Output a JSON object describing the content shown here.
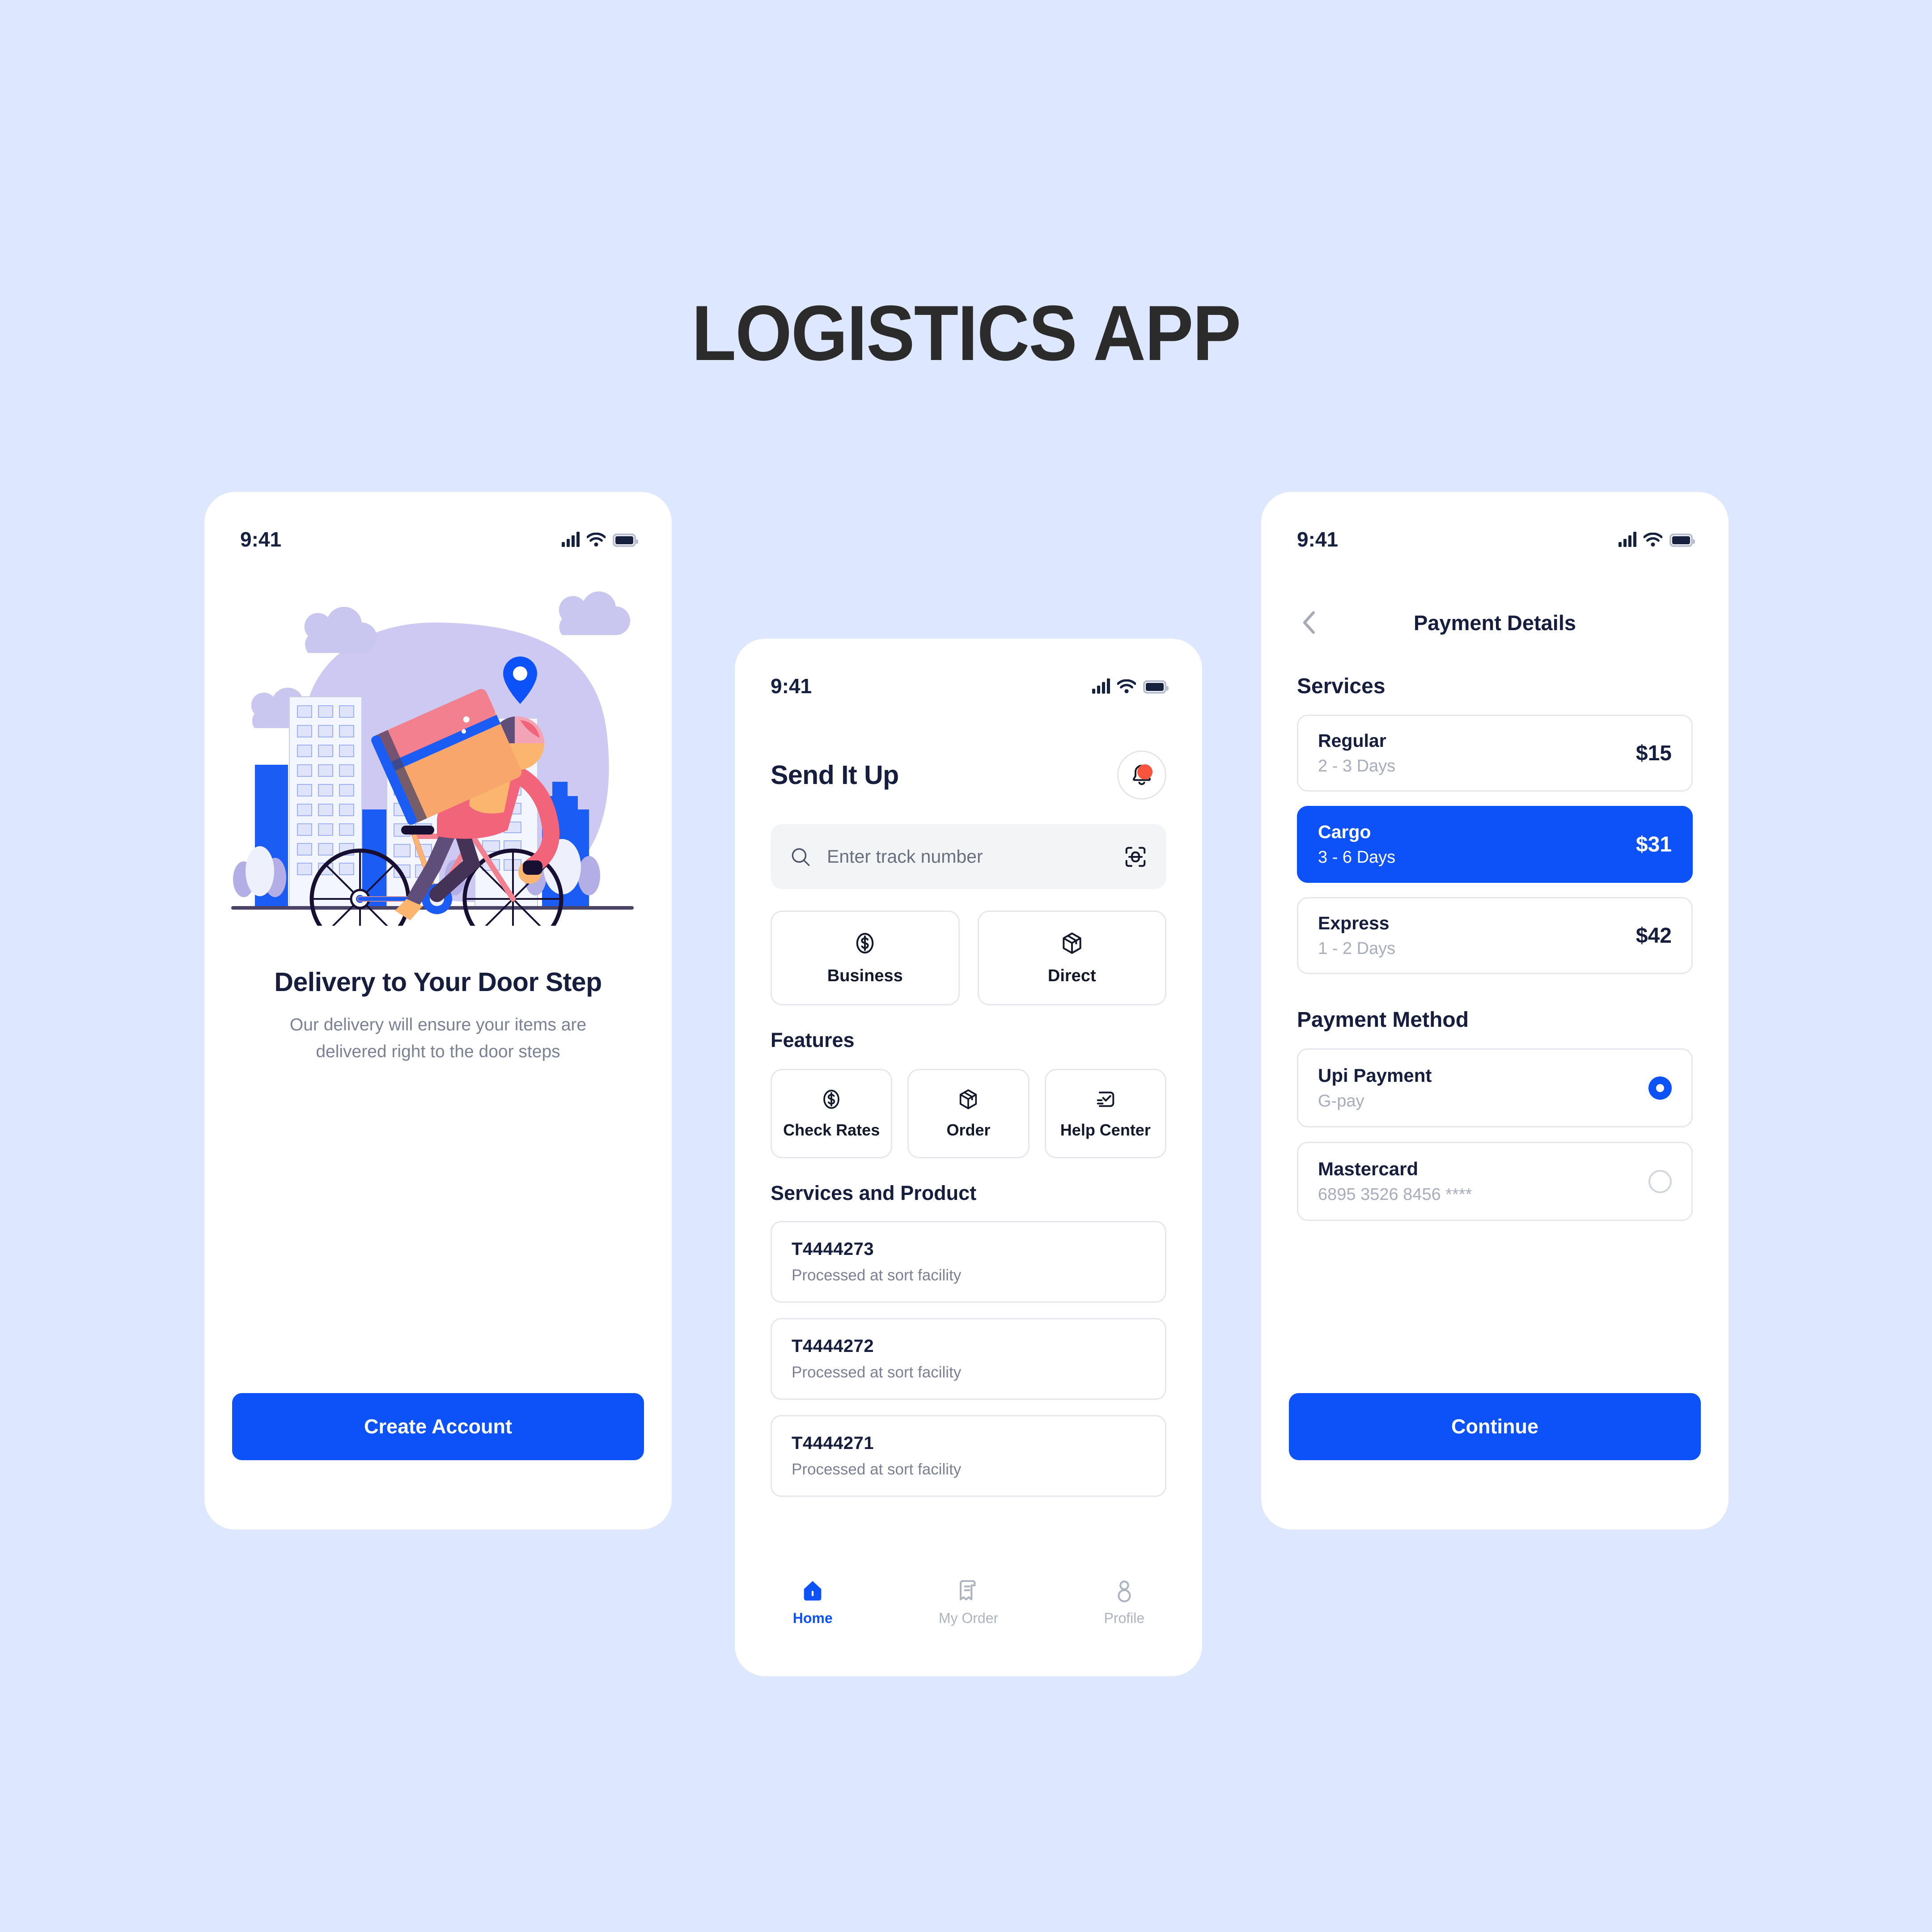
{
  "page": {
    "title": "LOGISTICS APP",
    "background_color": "#dde7ff",
    "accent_color": "#0d52f9",
    "notification_dot_color": "#f9543e"
  },
  "status_bar": {
    "time": "9:41",
    "icons": [
      "cellular-signal-icon",
      "wifi-icon",
      "battery-icon"
    ]
  },
  "onboarding_screen": {
    "illustration": "delivery-cyclist-illustration",
    "heading": "Delivery to Your Door Step",
    "subtitle": "Our delivery will ensure your items are delivered right to the door steps",
    "cta_label": "Create Account"
  },
  "home_screen": {
    "app_title": "Send It Up",
    "notification_icon": "bell-icon",
    "search": {
      "placeholder": "Enter track number",
      "value": "",
      "left_icon": "search-icon",
      "right_icon": "scan-barcode-icon"
    },
    "quick_tiles": [
      {
        "label": "Business",
        "icon": "dollar-circle-icon"
      },
      {
        "label": "Direct",
        "icon": "package-box-icon"
      }
    ],
    "features_heading": "Features",
    "features": [
      {
        "label": "Check Rates",
        "icon": "dollar-circle-icon"
      },
      {
        "label": "Order",
        "icon": "package-box-icon"
      },
      {
        "label": "Help Center",
        "icon": "chat-support-icon"
      }
    ],
    "services_heading": "Services and Product",
    "tracking_items": [
      {
        "id": "T4444273",
        "status": "Processed at sort facility"
      },
      {
        "id": "T4444272",
        "status": "Processed at sort facility"
      },
      {
        "id": "T4444271",
        "status": "Processed at sort facility"
      }
    ],
    "tabs": [
      {
        "label": "Home",
        "icon": "home-icon",
        "active": true
      },
      {
        "label": "My Order",
        "icon": "receipt-icon",
        "active": false
      },
      {
        "label": "Profile",
        "icon": "person-icon",
        "active": false
      }
    ]
  },
  "payment_screen": {
    "back_icon": "chevron-left-icon",
    "title": "Payment Details",
    "services_heading": "Services",
    "services": [
      {
        "name": "Regular",
        "duration": "2 - 3 Days",
        "price": "$15",
        "selected": false
      },
      {
        "name": "Cargo",
        "duration": "3 - 6 Days",
        "price": "$31",
        "selected": true
      },
      {
        "name": "Express",
        "duration": "1 - 2 Days",
        "price": "$42",
        "selected": false
      }
    ],
    "payment_method_heading": "Payment Method",
    "payment_methods": [
      {
        "name": "Upi Payment",
        "detail": "G-pay",
        "selected": true
      },
      {
        "name": "Mastercard",
        "detail": "6895 3526 8456 ****",
        "selected": false
      }
    ],
    "cta_label": "Continue"
  }
}
